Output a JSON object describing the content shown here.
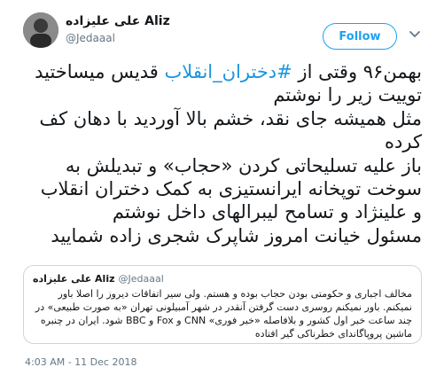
{
  "author": {
    "display_name_latin": "Aliz",
    "display_name_persian": "علی علیزاده",
    "handle": "@Jedaaal"
  },
  "follow_label": "Follow",
  "tweet": {
    "line1_pre": "بهمن۹۶ وقتی از ",
    "hashtag": "#دختران_انقلاب",
    "line1_post": " قدیس میساختید",
    "lines": [
      "توییت زیر را نوشتم",
      "مثل همیشه جای نقد، خشم بالا آوردید با دهان کف",
      "کرده",
      "باز علیه تسلیحاتی کردن «حجاب» و تبدیلش به",
      "سوخت توپخانه ایرانستیزی به کمک دختران انقلاب",
      "و علینژاد و تسامح لیبرالهای داخل نوشتم",
      "مسئول خیانت امروز شاپرک شجری زاده شمایید"
    ]
  },
  "quoted": {
    "name": "علی علیزاده Aliz",
    "handle": "@Jedaaal",
    "lines": [
      "مخالف اجباری و حکومتی بودن حجاب بوده و هستم. ولی سیر اتفاقات دیروز را اصلا باور",
      "نمیکنم. باور نمیکنم روسری دست گرفتن آنقدر در شهر آمبیلونی تهران «به صورت طبیعی» در",
      "چند ساعت خبر اول کشور و بلافاصله «خبر فوری» CNN و Fox و BBC شود. ایران در چنبره",
      "ماشین پروپاگاندای خطرناکی گیر افتاده"
    ]
  },
  "timestamp": "4:03 AM - 11 Dec 2018"
}
